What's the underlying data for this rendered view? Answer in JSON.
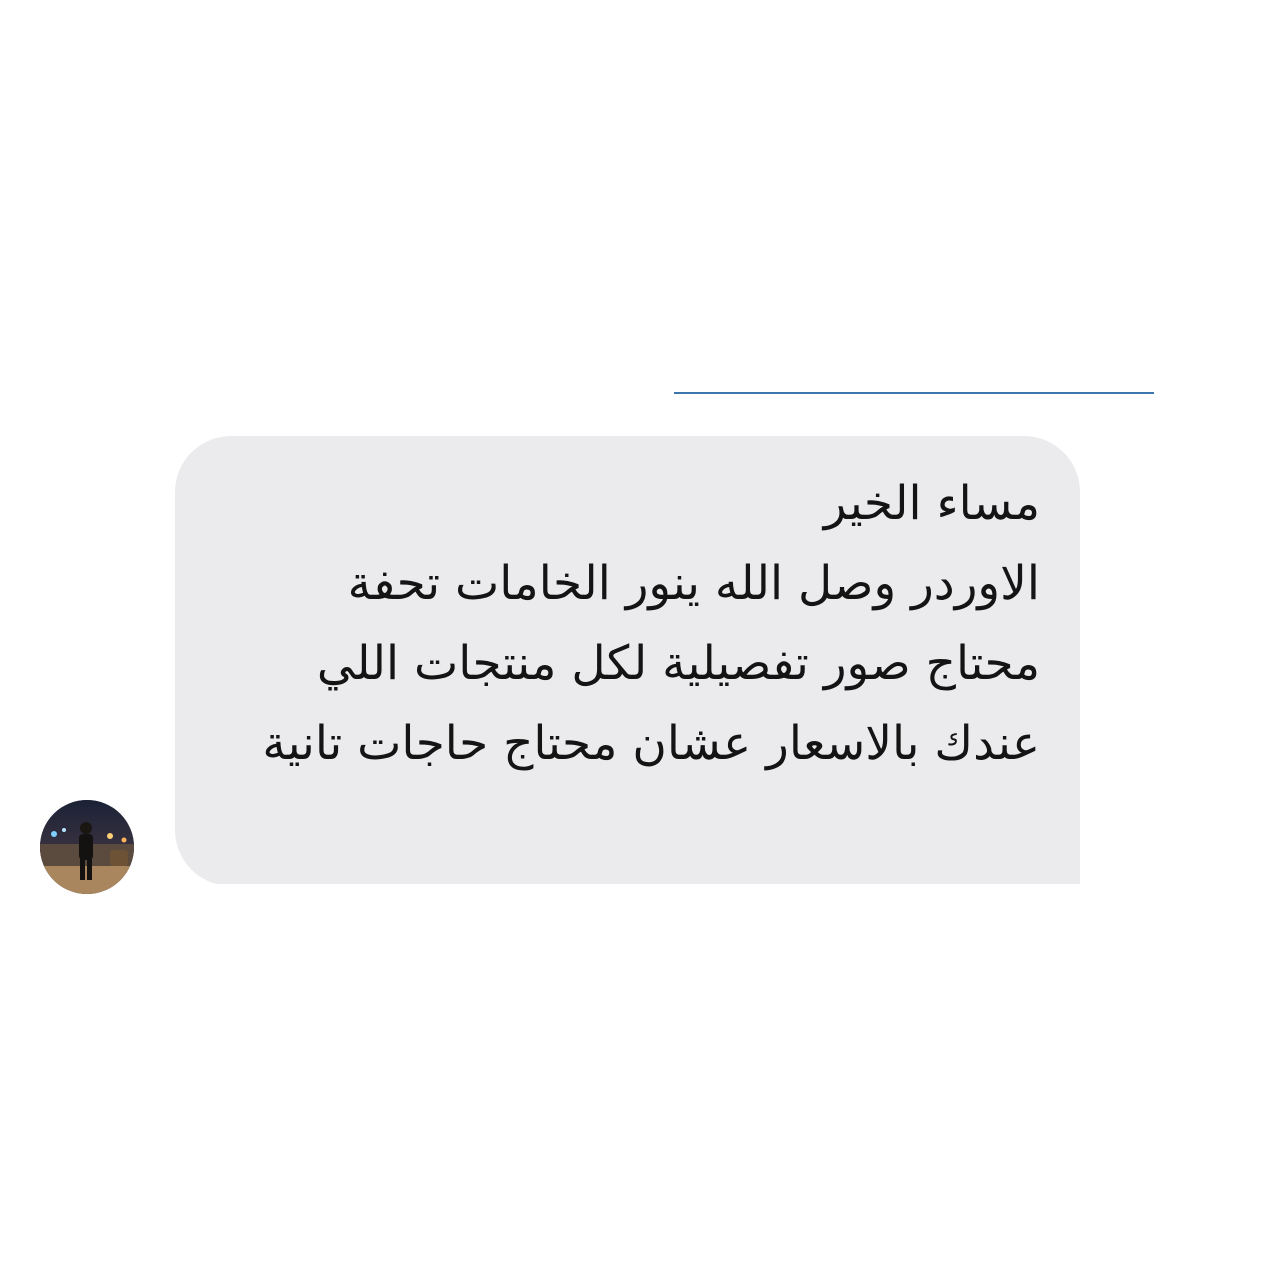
{
  "chat": {
    "message": {
      "text": "مساء الخير\nالاوردر وصل الله ينور الخامات تحفة\nمحتاج صور تفصيلية لكل منتجات اللي عندك بالاسعار عشان محتاج حاجات تانية"
    },
    "avatar": {
      "icon": "user-photo-avatar"
    }
  },
  "colors": {
    "bubble_background": "#ebebed",
    "divider": "#3d76ac",
    "text": "#141414",
    "page_background": "#ffffff"
  }
}
